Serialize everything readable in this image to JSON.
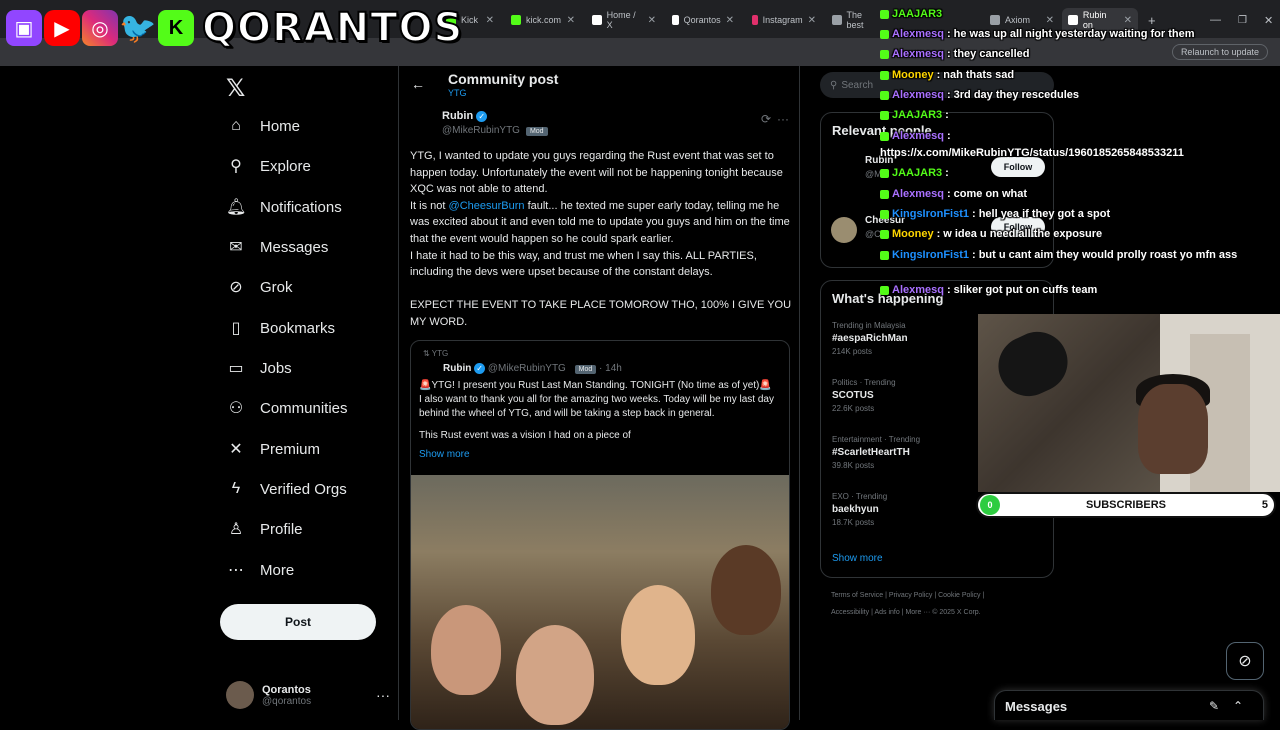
{
  "browser": {
    "tabs": [
      {
        "label": "Kick",
        "color": "#53fc18"
      },
      {
        "label": "kick.com",
        "color": "#53fc18"
      },
      {
        "label": "Home / X",
        "color": "#ffffff"
      },
      {
        "label": "Qorantos",
        "color": "#ffffff"
      },
      {
        "label": "Instagram",
        "color": "#e1306c"
      },
      {
        "label": "The best",
        "color": "#9aa0a6"
      },
      {
        "label": "Axiom",
        "color": "#9aa0a6"
      },
      {
        "label": "Rubin on",
        "color": "#ffffff"
      }
    ],
    "relaunch_label": "Relaunch to update"
  },
  "brand": {
    "name": "QORANTOS"
  },
  "nav": {
    "items": [
      {
        "label": "Home",
        "icon": "home-icon"
      },
      {
        "label": "Explore",
        "icon": "search-icon"
      },
      {
        "label": "Notifications",
        "icon": "bell-icon"
      },
      {
        "label": "Messages",
        "icon": "mail-icon"
      },
      {
        "label": "Grok",
        "icon": "grok-icon"
      },
      {
        "label": "Bookmarks",
        "icon": "bookmark-icon"
      },
      {
        "label": "Jobs",
        "icon": "briefcase-icon"
      },
      {
        "label": "Communities",
        "icon": "people-icon"
      },
      {
        "label": "Premium",
        "icon": "x-icon"
      },
      {
        "label": "Verified Orgs",
        "icon": "bolt-icon"
      },
      {
        "label": "Profile",
        "icon": "person-icon"
      },
      {
        "label": "More",
        "icon": "more-icon"
      }
    ],
    "post_label": "Post",
    "account": {
      "name": "Qorantos",
      "handle": "@qorantos"
    }
  },
  "post": {
    "header_title": "Community post",
    "header_sub": "YTG",
    "author_name": "Rubin",
    "author_handle": "@MikeRubinYTG",
    "mod_label": "Mod",
    "body1": "YTG, I wanted to update you guys regarding the Rust event that was set to happen today. Unfortunately the event will not be happening tonight because XQC was not able to attend.",
    "body2_pre": "It is not ",
    "body2_link": "@CheesurBurn",
    "body2_post": " fault... he texted me super early today, telling me he was excited about it and even told me to update you guys and  him on the time that the event would happen so he could spark earlier.",
    "body3": "I hate it had to be this way, and trust me when I say this. ALL PARTIES, including the devs were upset because of the constant delays.",
    "body4": "EXPECT THE EVENT TO TAKE PLACE TOMOROW THO, 100% I GIVE YOU MY WORD.",
    "quote": {
      "context": "YTG",
      "author_name": "Rubin",
      "author_handle": "@MikeRubinYTG",
      "mod_label": "Mod",
      "time": "14h",
      "line1": "🚨YTG! I present you Rust Last Man Standing. TONIGHT (No time as of yet)🚨",
      "line2": "I also want to thank you all for the amazing two weeks. Today will be my last day behind the wheel of YTG, and will be taking a step back in general.",
      "line3": "This Rust event was a vision I had on a piece of",
      "show_more": "Show more"
    }
  },
  "sidebar": {
    "search_placeholder": "Search",
    "relevant_title": "Relevant people",
    "people": [
      {
        "name": "Rubin",
        "handle": "@M",
        "follow": "Follow"
      },
      {
        "name": "Cheesur",
        "handle": "@C",
        "follow": "Follow"
      }
    ],
    "happening_title": "What's happening",
    "trends": [
      {
        "context": "Trending in Malaysia",
        "name": "#aespaRichMan",
        "posts": "214K posts"
      },
      {
        "context": "Politics · Trending",
        "name": "SCOTUS",
        "posts": "22.6K posts"
      },
      {
        "context": "Entertainment · Trending",
        "name": "#ScarletHeartTH",
        "posts": "39.8K posts"
      },
      {
        "context": "EXO · Trending",
        "name": "baekhyun",
        "posts": "18.7K posts"
      }
    ],
    "show_more": "Show more",
    "footer1": "Terms of Service  |  Privacy Policy  |  Cookie Policy  |",
    "footer2": "Accessibility  |  Ads info  |  More ···  © 2025 X Corp."
  },
  "chat": [
    {
      "user": "JAAJAR3",
      "msg": "",
      "color": "#53fc18"
    },
    {
      "user": "Alexmesq",
      "msg": "he was up all night yesterday waiting for them",
      "color": "#a970ff"
    },
    {
      "user": "Alexmesq",
      "msg": "they cancelled",
      "color": "#a970ff"
    },
    {
      "user": "Mooney",
      "msg": "nah thats sad",
      "color": "#ffd700"
    },
    {
      "user": "Alexmesq",
      "msg": "3rd day they rescedules",
      "color": "#a970ff"
    },
    {
      "user": "JAAJAR3",
      "msg": "",
      "color": "#53fc18"
    },
    {
      "user": "Alexmesq",
      "msg": "",
      "color": "#a970ff"
    },
    {
      "user": "",
      "msg": "https://x.com/MikeRubinYTG/status/1960185265848533211",
      "color": "#ffffff"
    },
    {
      "user": "JAAJAR3",
      "msg": "",
      "color": "#53fc18"
    },
    {
      "user": "Alexmesq",
      "msg": "come on what",
      "color": "#a970ff"
    },
    {
      "user": "KingsIronFist1",
      "msg": "hell yea if they got a spot",
      "color": "#1e90ff"
    },
    {
      "user": "Mooney",
      "msg": "w idea u need all the exposure",
      "color": "#ffd700"
    },
    {
      "user": "KingsIronFist1",
      "msg": "but u cant aim they would prolly roast yo mfn ass",
      "color": "#1e90ff"
    },
    {
      "user": "Alexmesq",
      "msg": "sliker got put on cuffs team",
      "color": "#a970ff"
    }
  ],
  "subbar": {
    "count": "0",
    "label": "SUBSCRIBERS",
    "goal": "5"
  },
  "messages_dock": {
    "title": "Messages"
  }
}
